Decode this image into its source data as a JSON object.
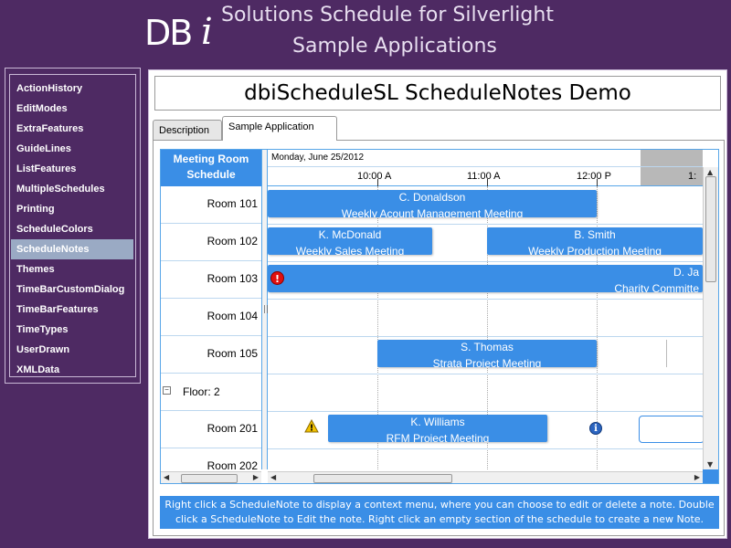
{
  "header": {
    "logo_text": "DB",
    "logo_i": "i",
    "title": "Solutions Schedule for Silverlight",
    "subtitle": "Sample Applications"
  },
  "sidebar": {
    "items": [
      {
        "label": "ActionHistory"
      },
      {
        "label": "EditModes"
      },
      {
        "label": "ExtraFeatures"
      },
      {
        "label": "GuideLines"
      },
      {
        "label": "ListFeatures"
      },
      {
        "label": "MultipleSchedules"
      },
      {
        "label": "Printing"
      },
      {
        "label": "ScheduleColors"
      },
      {
        "label": "ScheduleNotes",
        "selected": true
      },
      {
        "label": "Themes"
      },
      {
        "label": "TimeBarCustomDialog"
      },
      {
        "label": "TimeBarFeatures"
      },
      {
        "label": "TimeTypes"
      },
      {
        "label": "UserDrawn"
      },
      {
        "label": "XMLData"
      }
    ],
    "selected_color": "#9aaac4"
  },
  "main": {
    "title": "dbiScheduleSL ScheduleNotes Demo",
    "tabs": [
      {
        "label": "Description"
      },
      {
        "label": "Sample Application",
        "active": true
      }
    ]
  },
  "schedule": {
    "resource_header": "Meeting Room Schedule",
    "date": "Monday, June 25/2012",
    "times": [
      "10:00 A",
      "11:00 A",
      "12:00 P",
      "1:"
    ],
    "resources": [
      {
        "label": "Room 101"
      },
      {
        "label": "Room 102"
      },
      {
        "label": "Room 103"
      },
      {
        "label": "Room 104"
      },
      {
        "label": "Room 105"
      },
      {
        "label": "Floor: 2",
        "group": true,
        "toggle": "−"
      },
      {
        "label": "Room 201"
      },
      {
        "label": "Room 202"
      }
    ],
    "appointments": [
      {
        "name": "C. Donaldson",
        "title": "Weekly Acount Management Meeting"
      },
      {
        "name": "K. McDonald",
        "title": "Weekly Sales Meeting"
      },
      {
        "name": "B. Smith",
        "title": "Weekly Production Meeting"
      },
      {
        "name": "D. Ja",
        "title": "Charity Committe"
      },
      {
        "name": "S. Thomas",
        "title": "Strata Project Meeting"
      },
      {
        "name": "K. Williams",
        "title": "RFM Project Meeting"
      }
    ],
    "notes": [
      {
        "type": "error-icon",
        "glyph": "!"
      },
      {
        "type": "warning-icon",
        "glyph": "!"
      },
      {
        "type": "info-icon",
        "glyph": "i"
      }
    ],
    "accent_color": "#3a8ee6"
  },
  "info_bar": {
    "text": "Right click a ScheduleNote to display a context menu, where you can choose to edit or delete a note. Double click a ScheduleNote to Edit the note. Right click an empty section of the schedule to create a new Note."
  }
}
